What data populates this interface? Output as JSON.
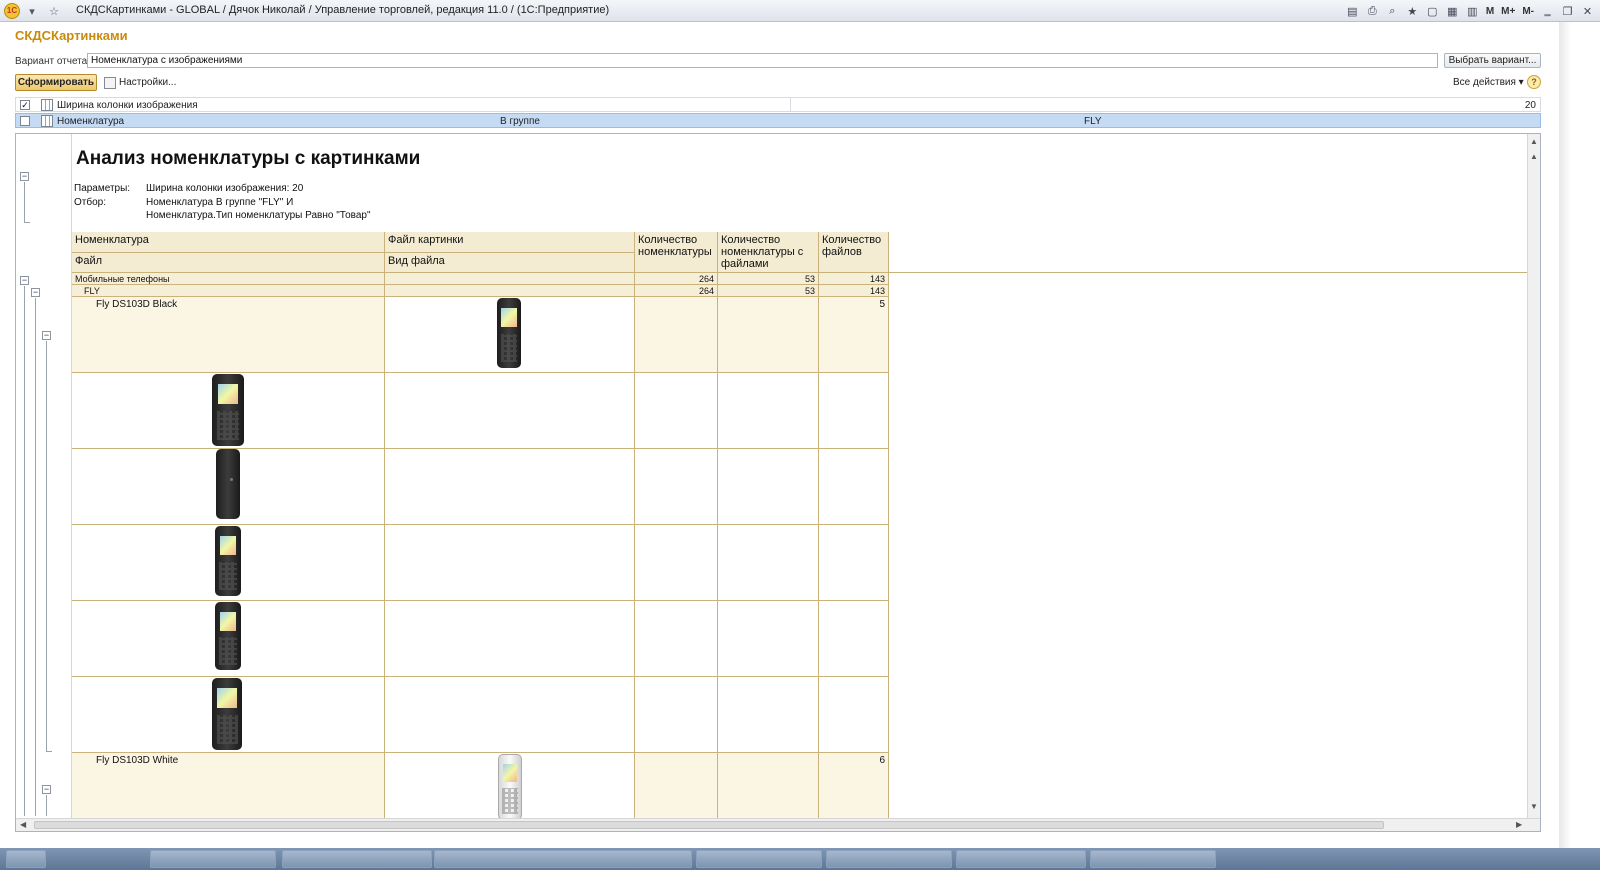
{
  "window": {
    "title": "СКДСКартинками - GLOBAL / Дячок Николай /  Управление торговлей, редакция 11.0 /  (1С:Предприятие)",
    "logo_text": "1C",
    "right_buttons": [
      "M",
      "M+",
      "M-"
    ]
  },
  "form": {
    "title": "СКДСКартинками",
    "variant_label": "Вариант отчета:",
    "variant_value": "Номенклатура с изображениями",
    "choose_variant_button": "Выбрать вариант...",
    "generate_button": "Сформировать",
    "settings_button": "Настройки...",
    "all_actions": "Все действия ▾",
    "help": "?"
  },
  "settings_rows": [
    {
      "checked": true,
      "name": "Ширина колонки изображения",
      "condition": "",
      "value": "20"
    },
    {
      "checked": false,
      "name": "Номенклатура",
      "condition": "В группе",
      "value": "FLY"
    }
  ],
  "report": {
    "title": "Анализ номенклатуры с картинками",
    "params_label": "Параметры:",
    "params_value": "Ширина колонки изображения: 20",
    "filter_label": "Отбор:",
    "filter_line1": "Номенклатура В группе \"FLY\" И",
    "filter_line2": "Номенклатура.Тип номенклатуры Равно \"Товар\"",
    "headers": {
      "nomenclature": "Номенклатура",
      "file": "Файл",
      "image_file": "Файл картинки",
      "file_type": "Вид файла",
      "count_nom": "Количество номенклатуры",
      "count_nom_files": "Количество номенклатуры с файлами",
      "count_files": "Количество файлов"
    },
    "groups": [
      {
        "name": "Мобильные телефоны",
        "count_nom": "264",
        "count_nom_files": "53",
        "count_files": "143"
      },
      {
        "name": "FLY",
        "count_nom": "264",
        "count_nom_files": "53",
        "count_files": "143"
      }
    ],
    "items": [
      {
        "name": "Fly DS103D Black",
        "count_files": "5"
      },
      {
        "name": "Fly DS103D White",
        "count_files": "6"
      }
    ]
  },
  "colors": {
    "accent_title": "#c98b0b",
    "header_bg": "#f3ecd2",
    "selected_row": "#c5dbf4"
  },
  "icons": [
    "star-icon",
    "save-icon",
    "print-icon",
    "preview-icon",
    "favorites-icon",
    "calendar-icon",
    "minimize-icon",
    "restore-icon",
    "close-icon",
    "help-icon",
    "settings-icon",
    "collapse-icon"
  ]
}
